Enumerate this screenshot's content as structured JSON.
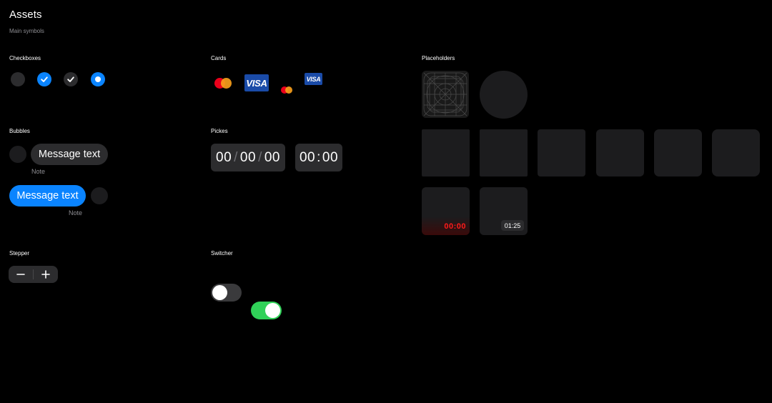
{
  "header": {
    "title": "Assets",
    "subtitle": "Main symbols"
  },
  "sections": {
    "checkboxes": "Checkboxes",
    "cards": "Cards",
    "placeholders": "Placeholders",
    "bubbles": "Bubbles",
    "pickers": "Pickes",
    "stepper": "Stepper",
    "switcher": "Switcher"
  },
  "checkboxes": [
    {
      "state": "unchecked"
    },
    {
      "state": "checked-blue"
    },
    {
      "state": "checked-dark"
    },
    {
      "state": "radio-selected"
    }
  ],
  "cards": {
    "visa_label": "VISA",
    "visa_label_small": "VISA"
  },
  "bubbles": {
    "incoming_text": "Message text",
    "incoming_note": "Note",
    "outgoing_text": "Message text",
    "outgoing_note": "Note"
  },
  "pickers": {
    "date": {
      "h": "00",
      "m": "00",
      "s": "00",
      "sep": "/"
    },
    "time": {
      "h": "00",
      "m": "00",
      "sep": ":"
    }
  },
  "placeholders": {
    "recording_timer": "00:00",
    "video_duration": "01:25"
  },
  "stepper": {
    "minus": "−",
    "plus": "+"
  },
  "switcher": [
    {
      "state": "off"
    },
    {
      "state": "on"
    }
  ],
  "colors": {
    "background": "#000000",
    "accent_blue": "#0a84ff",
    "switch_on": "#30d158",
    "surface": "#2c2c2e",
    "placeholder": "#1c1c1e",
    "record_red": "#ff1a1a",
    "visa_blue": "#1a4ba8",
    "mastercard_red": "#eb001b",
    "mastercard_orange": "#f79e1b"
  }
}
